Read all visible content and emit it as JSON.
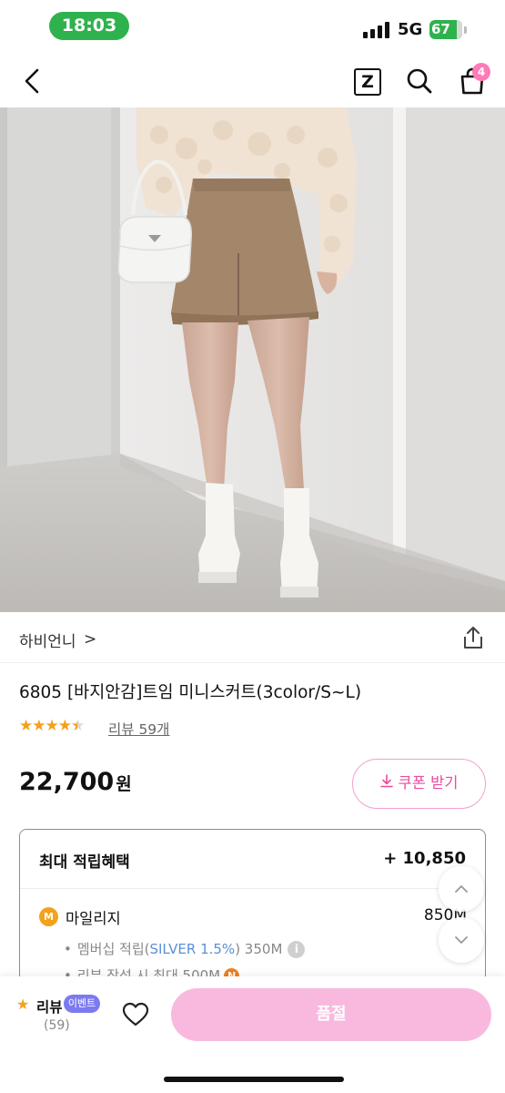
{
  "status_bar": {
    "time": "18:03",
    "network": "5G",
    "battery": "67"
  },
  "header": {
    "back_icon": "chevron-left-icon",
    "z_label": "Z",
    "search_icon": "search-icon",
    "cart_icon": "shopping-bag-icon",
    "cart_count": "4"
  },
  "product": {
    "image_description_icon": "product-photo",
    "brand": "하비언니",
    "brand_chevron": ">",
    "title": "6805 [바지안감]트임 미니스커트(3color/S~L)",
    "rating": 4.5,
    "rating_stars": "★★★★★",
    "review_link": "리뷰 59개",
    "price": "22,700",
    "price_unit": "원",
    "coupon_label": "쿠폰 받기"
  },
  "benefits": {
    "title": "최대 적립혜택",
    "total": "+ 10,850",
    "mileage_icon_letter": "M",
    "mileage_label": "마일리지",
    "mileage_value": "850M",
    "membership_prefix": "멤버십 적립(",
    "membership_tier": "SILVER 1.5%",
    "membership_suffix": ") 350M",
    "info_mark": "i",
    "review_reward": "리뷰 작성 시 최대 500M",
    "n_mark": "N"
  },
  "bottom_bar": {
    "review_label": "리뷰",
    "event_badge": "이벤트",
    "review_count": "(59)",
    "soldout_label": "품절"
  },
  "colors": {
    "accent_pink": "#e84c9e",
    "soldout_pink": "#f9b9df",
    "star_orange": "#f4a11b",
    "status_green": "#2fb24e",
    "event_purple": "#7b7bef"
  }
}
